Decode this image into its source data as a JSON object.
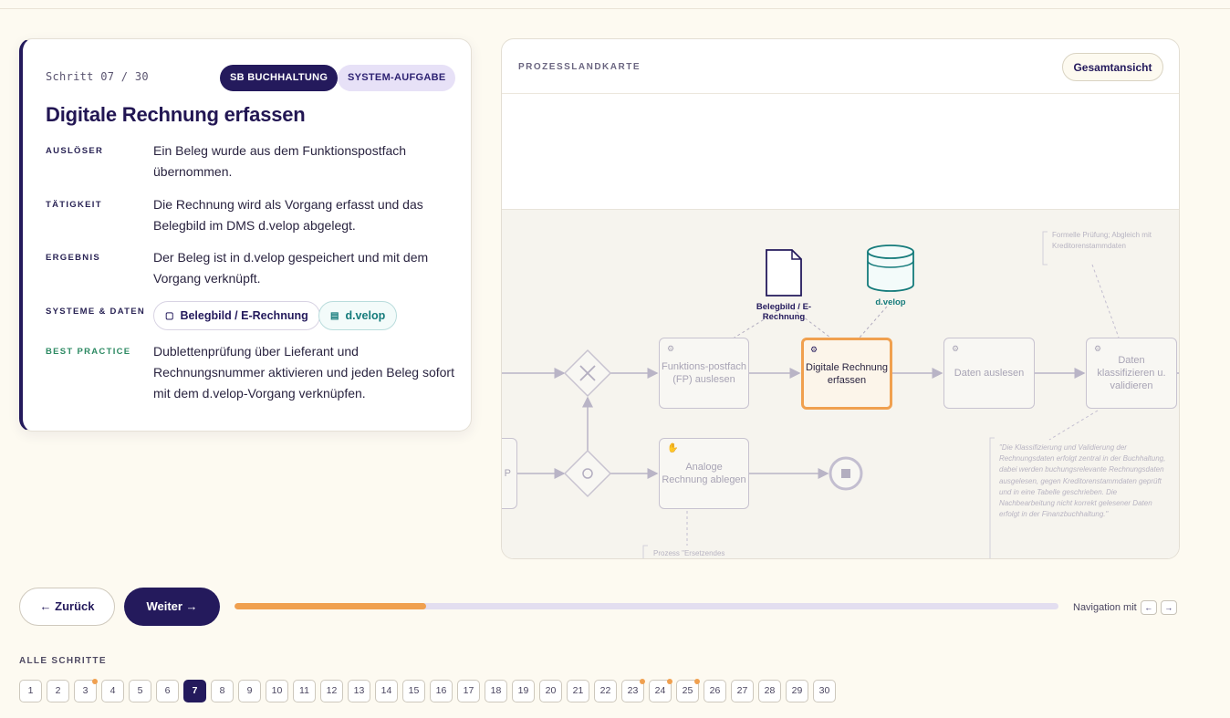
{
  "step": {
    "counter": "Schritt 07 / 30",
    "badge_role": "SB BUCHHALTUNG",
    "badge_type": "SYSTEM-AUFGABE",
    "title": "Digitale Rechnung erfassen",
    "rows": [
      {
        "label": "AUSLÖSER",
        "text": "Ein Beleg wurde aus dem Funktionspostfach übernommen."
      },
      {
        "label": "TÄTIGKEIT",
        "text": "Die Rechnung wird als Vorgang erfasst und das Belegbild im DMS d.velop abgelegt."
      },
      {
        "label": "ERGEBNIS",
        "text": "Der Beleg ist in d.velop gespeichert und mit dem Vorgang verknüpft."
      },
      {
        "label": "SYSTEME & DATEN"
      },
      {
        "label": "BEST PRACTICE",
        "text": "Dublettenprüfung über Lieferant und Rechnungsnummer aktivieren und jeden Beleg sofort mit dem d.velop-Vorgang verknüpfen."
      }
    ],
    "chips": [
      {
        "icon": "document-icon",
        "label": "Belegbild / E-Rechnung"
      },
      {
        "icon": "database-icon",
        "label": "d.velop"
      }
    ]
  },
  "map": {
    "title": "PROZESSLANDKARTE",
    "overview_button": "Gesamtansicht",
    "tasks": {
      "fp": "Funktions-postfach (FP) auslesen",
      "digital": "Digitale Rechnung erfassen",
      "daten": "Daten auslesen",
      "klass": "Daten klassifizieren u. validieren",
      "analog": "Analoge Rechnung ablegen",
      "left": "P"
    },
    "artifacts": {
      "document": "Belegbild / E-Rechnung",
      "database": "d.velop"
    },
    "notes": {
      "top": "Formelle Prüfung; Abgleich mit Kreditorenstammdaten",
      "right": "\"Die Klassifizierung und Validierung der Rechnungsdaten erfolgt zentral in der Buchhaltung, dabei werden buchungsrelevante Rechnungsdaten ausgelesen, gegen Kreditorenstammdaten geprüft und in eine Tabelle geschrieben. Die Nachbearbeitung nicht korrekt gelesener Daten erfolgt in der Finanzbuchhaltung.\"",
      "bottom": "Prozess \"Ersetzendes"
    },
    "colors": {
      "active": "#f0a04f",
      "database": "#157b7b",
      "document": "#241a5c"
    }
  },
  "nav": {
    "back": "← Zurück",
    "next": "Weiter →",
    "progress": 0.233,
    "hint": "Navigation mit",
    "key_left": "←",
    "key_right": "→"
  },
  "all_steps": {
    "label": "ALLE SCHRITTE",
    "current": 7,
    "items": [
      {
        "n": "1"
      },
      {
        "n": "2"
      },
      {
        "n": "3",
        "dot": true
      },
      {
        "n": "4"
      },
      {
        "n": "5"
      },
      {
        "n": "6"
      },
      {
        "n": "7"
      },
      {
        "n": "8"
      },
      {
        "n": "9"
      },
      {
        "n": "10"
      },
      {
        "n": "11"
      },
      {
        "n": "12"
      },
      {
        "n": "13"
      },
      {
        "n": "14"
      },
      {
        "n": "15"
      },
      {
        "n": "16"
      },
      {
        "n": "17"
      },
      {
        "n": "18"
      },
      {
        "n": "19"
      },
      {
        "n": "20"
      },
      {
        "n": "21"
      },
      {
        "n": "22"
      },
      {
        "n": "23",
        "dot": true
      },
      {
        "n": "24",
        "dot": true
      },
      {
        "n": "25",
        "dot": true
      },
      {
        "n": "26"
      },
      {
        "n": "27"
      },
      {
        "n": "28"
      },
      {
        "n": "29"
      },
      {
        "n": "30"
      }
    ]
  }
}
